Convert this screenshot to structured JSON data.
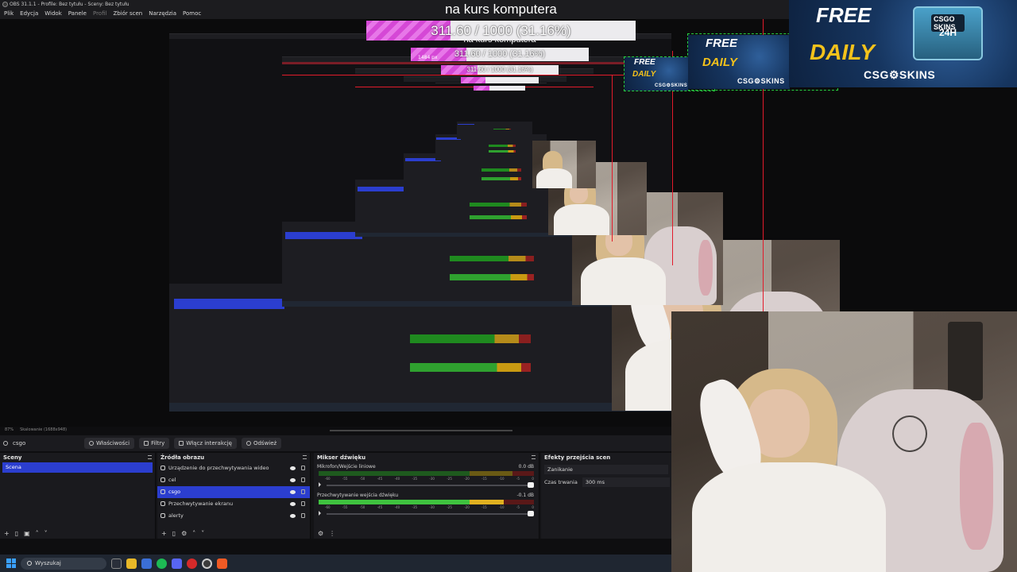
{
  "window": {
    "title": "OBS 31.1.1 - Profile: Bez tytułu - Sceny: Bez tytułu"
  },
  "menu": [
    "Plik",
    "Edycja",
    "Widok",
    "Panele",
    "Profil",
    "Zbiór scen",
    "Narzędzia",
    "Pomoc"
  ],
  "overlay": {
    "goal_title": "na kurs komputera",
    "goal_text": "311.60 / 1000 (31.16%)",
    "goal_fraction": 0.3116,
    "goal_color": "#d548d6",
    "nested_size_label": "1484 px"
  },
  "ad": {
    "free": "FREE",
    "daily": "DAILY",
    "brand": "CSG⚙SKINS",
    "crate_label": "CSGO SKINS",
    "crate_24": "24H"
  },
  "status": {
    "zoom": "87%",
    "scaling": "Skalowanie (1688x948)"
  },
  "toolbar": {
    "source": "csgo",
    "properties": "Właściwości",
    "filters": "Filtry",
    "interact": "Włącz interakcję",
    "refresh": "Odśwież"
  },
  "scenes": {
    "title": "Sceny",
    "items": [
      "Scena"
    ]
  },
  "sources": {
    "title": "Źródła obrazu",
    "items": [
      "Urządzenie do przechwytywania wideo",
      "cel",
      "csgo",
      "Przechwytywanie ekranu",
      "alerty"
    ],
    "selected_index": 2
  },
  "mixer": {
    "title": "Mikser dźwięku",
    "channels": [
      {
        "name": "Mikrofon/Wejście liniowe",
        "db": "0.0 dB",
        "level": 0.0
      },
      {
        "name": "Przechwytywanie wejścia dźwięku",
        "db": "-0.1 dB",
        "level": 0.86
      }
    ],
    "scale": [
      "-60",
      "-55",
      "-50",
      "-45",
      "-40",
      "-35",
      "-30",
      "-25",
      "-20",
      "-15",
      "-10",
      "-5",
      "0"
    ]
  },
  "transitions": {
    "title": "Efekty przejścia scen",
    "effect": "Zanikanie",
    "duration_label": "Czas trwania",
    "duration_value": "300 ms"
  },
  "taskbar": {
    "search": "Wyszukaj"
  },
  "colors": {
    "accent": "#2b3ecf",
    "red_guide": "#e21b2b",
    "green_guide": "#27d040",
    "ad_yellow": "#f4c21b"
  }
}
